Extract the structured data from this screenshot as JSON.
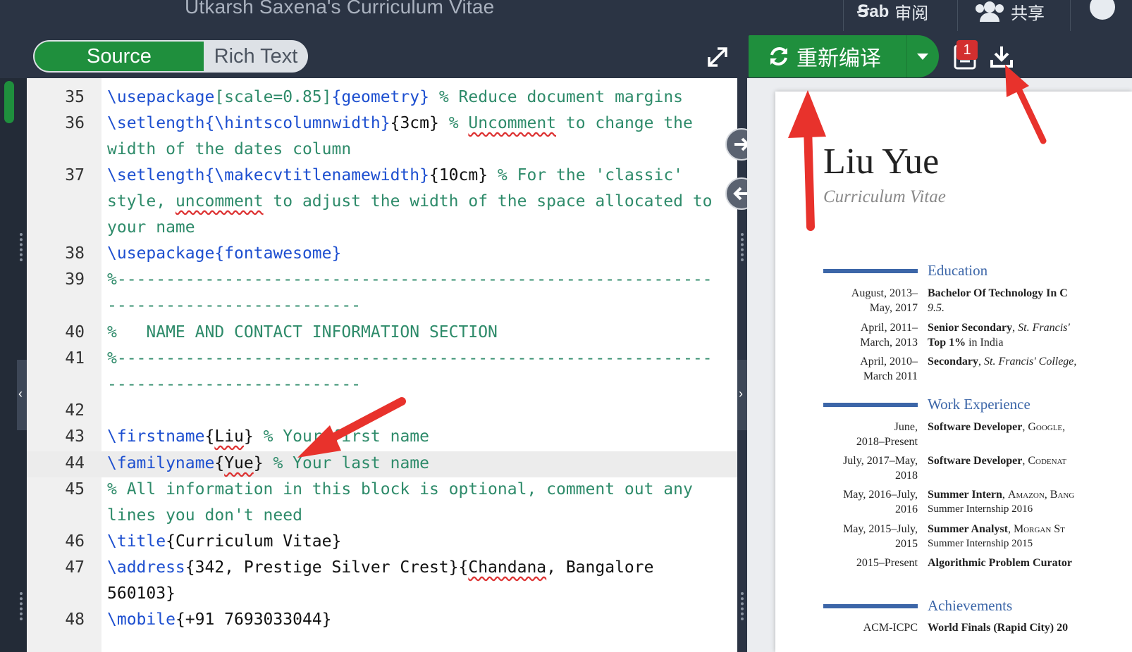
{
  "window": {
    "title": "Utkarsh Saxena's Curriculum Vitae"
  },
  "topbar": {
    "review_label": "审阅",
    "share_label": "共享"
  },
  "toolbar": {
    "source_label": "Source",
    "richtext_label": "Rich Text",
    "recompile_label": "重新编译",
    "logs_badge": "1"
  },
  "editor": {
    "line_numbers": [
      "35",
      "36",
      "37",
      "38",
      "39",
      "40",
      "41",
      "42",
      "43",
      "44",
      "45",
      "46",
      "47",
      "48"
    ],
    "active_line": "44"
  },
  "code": {
    "l35": [
      "\\usepackage",
      "[scale=0.85]",
      "{geometry}",
      " % Reduce document margins"
    ],
    "l36a": [
      "\\setlength",
      "{\\hintscolumnwidth}",
      "{3cm}",
      " % ",
      "Uncomment",
      " to change the"
    ],
    "l36b": "width of the dates column",
    "l37a": [
      "\\setlength",
      "{\\makecvtitlenamewidth}",
      "{10cm}",
      " % For the 'classic'"
    ],
    "l37b": [
      "style, ",
      "uncomment",
      " to adjust the width of the space allocated to"
    ],
    "l37c": "your name",
    "l38": [
      "\\usepackage",
      "{fontawesome}"
    ],
    "l39a": "%-------------------------------------------------------------",
    "l39b": "--------------------------",
    "l40": "%   NAME AND CONTACT INFORMATION SECTION",
    "l41a": "%-------------------------------------------------------------",
    "l41b": "--------------------------",
    "l43": [
      "\\firstname",
      "{",
      "Liu",
      "}",
      " % Your first name"
    ],
    "l44": [
      "\\familyname",
      "{",
      "Yue",
      "}",
      " % Your last name"
    ],
    "l45a": "% All information in this block is optional, comment out any",
    "l45b": "lines you don't need",
    "l46": [
      "\\title",
      "{Curriculum Vitae}"
    ],
    "l47a": [
      "\\address",
      "{342, Prestige Silver Crest}{",
      "Chandana",
      ", Bangalore"
    ],
    "l47b": "560103}",
    "l48": [
      "\\mobile",
      "{+91 7693033044}"
    ]
  },
  "preview": {
    "name": "Liu Yue",
    "subtitle": "Curriculum Vitae",
    "sections": {
      "education": "Education",
      "work": "Work Experience",
      "achievements": "Achievements"
    },
    "education": [
      {
        "date1": "August, 2013–",
        "date2": "May, 2017",
        "title": "Bachelor Of Technology In C",
        "line2": "9.5."
      },
      {
        "date1": "April, 2011–",
        "date2": "March, 2013",
        "title": "Senior Secondary",
        "org": "St. Francis'",
        "line2a": "Top 1%",
        "line2b": " in India"
      },
      {
        "date1": "April, 2010–",
        "date2": "March 2011",
        "title": "Secondary",
        "org": "St. Francis' College,"
      }
    ],
    "work": [
      {
        "date1": "June,",
        "date2": "2018–Present",
        "title": "Software Developer",
        "org": "Google,"
      },
      {
        "date1": "July, 2017–May,",
        "date2": "2018",
        "title": "Software Developer",
        "org": "Codenat"
      },
      {
        "date1": "May, 2016–July,",
        "date2": "2016",
        "title": "Summer Intern",
        "org": "Amazon, Bang",
        "line2": "Summer Internship 2016"
      },
      {
        "date1": "May, 2015–July,",
        "date2": "2015",
        "title": "Summer Analyst",
        "org": "Morgan St",
        "line2": "Summer Internship 2015"
      },
      {
        "date1": "2015–Present",
        "title": "Algorithmic Problem Curator"
      }
    ],
    "achievements": [
      {
        "date1": "ACM-ICPC",
        "title": "World Finals (Rapid City) 20"
      }
    ]
  },
  "colors": {
    "green": "#1f8f3d",
    "keyword": "#1d4fd0",
    "comment": "#2e8b6a",
    "cv_accent": "#3c66a8",
    "arrow": "#e8322c"
  }
}
